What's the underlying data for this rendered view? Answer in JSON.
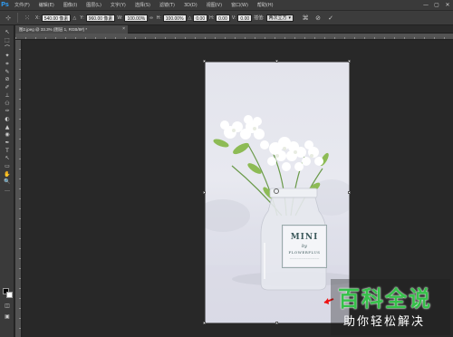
{
  "app": {
    "logo": "Ps",
    "logo_color": "#2fa3ff"
  },
  "menu": [
    "文件(F)",
    "编辑(E)",
    "图像(I)",
    "图层(L)",
    "文字(Y)",
    "选择(S)",
    "滤镜(T)",
    "3D(D)",
    "视图(V)",
    "窗口(W)",
    "帮助(H)"
  ],
  "window_controls": [
    "—",
    "▢",
    "✕"
  ],
  "options": {
    "x_label": "X:",
    "x_value": "540.00 像素",
    "y_label": "Y:",
    "y_value": "960.00 像素",
    "w_label": "W:",
    "w_value": "100.00%",
    "h_label": "H:",
    "h_value": "100.00%",
    "angle_label": "△",
    "angle_value": "0.00",
    "hskew_label": "H:",
    "hskew_value": "0.00",
    "vskew_label": "V:",
    "vskew_value": "0.00",
    "interp_label": "插值:",
    "interp_value": "两次立方"
  },
  "tools": [
    "↖",
    "⬚",
    "⌒",
    "✦",
    "⌗",
    "✎",
    "⊘",
    "✐",
    "⊥",
    "⚇",
    "✑",
    "◐",
    "▲",
    "◉",
    "✒",
    "T",
    "↖",
    "▭",
    "✋",
    "🔍",
    "…"
  ],
  "document": {
    "tab_label": "图2.jpeg @ 33.3% (图层 1, RGB/8#) *",
    "close": "×"
  },
  "photo": {
    "label_line1": "MINI",
    "label_line2": "by",
    "label_line3": "FLOWERPLUS",
    "label_line4": "—————————————"
  },
  "watermark": {
    "title": "百科全说",
    "subtitle": "助你轻松解决",
    "title_color": "#36c04a"
  }
}
